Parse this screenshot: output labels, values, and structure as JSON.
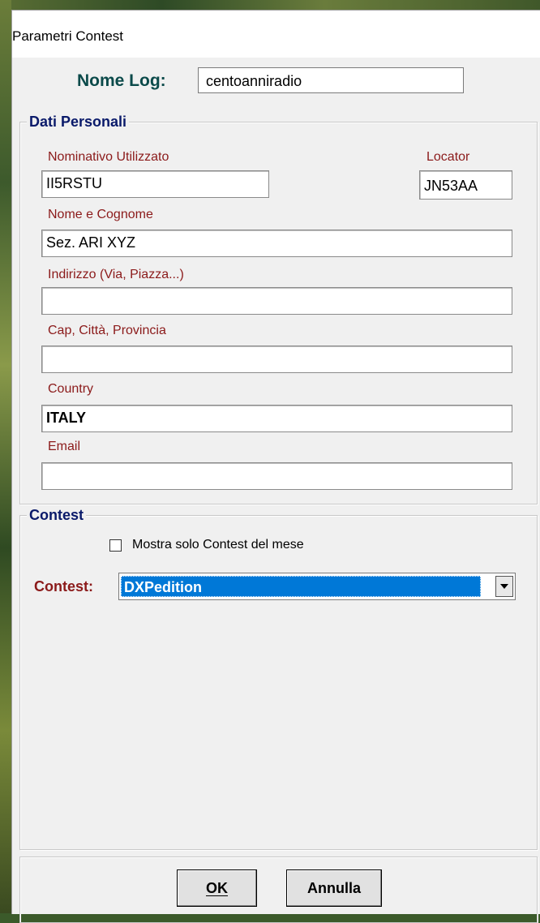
{
  "window": {
    "title": "Parametri Contest"
  },
  "header": {
    "nome_log_label": "Nome Log:",
    "nome_log_value": "centoanniradio"
  },
  "dati_personali": {
    "title": "Dati Personali",
    "nominativo_label": "Nominativo Utilizzato",
    "nominativo_value": "II5RSTU",
    "locator_label": "Locator",
    "locator_value": "JN53AA",
    "nome_label": "Nome e Cognome",
    "nome_value": "Sez. ARI XYZ",
    "indirizzo_label": "Indirizzo (Via, Piazza...)",
    "indirizzo_value": "",
    "cap_label": "Cap, Città, Provincia",
    "cap_value": "",
    "country_label": "Country",
    "country_value": "ITALY",
    "email_label": "Email",
    "email_value": ""
  },
  "contest": {
    "title": "Contest",
    "checkbox_label": "Mostra solo Contest del mese",
    "checkbox_checked": false,
    "select_label": "Contest:",
    "select_value": "DXPedition"
  },
  "buttons": {
    "ok_label": "OK",
    "annulla_label": "Annulla"
  }
}
